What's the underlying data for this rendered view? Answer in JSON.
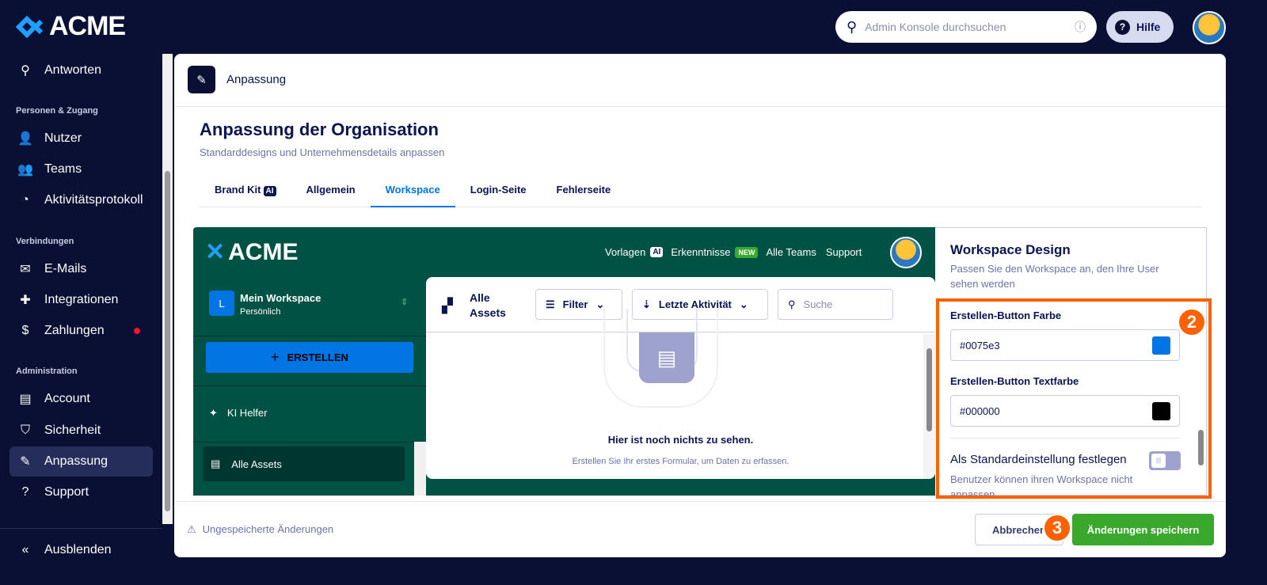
{
  "brand": "ACME",
  "search": {
    "placeholder": "Admin Konsole durchsuchen"
  },
  "help_label": "Hilfe",
  "sidebar": {
    "top": {
      "label": "Antworten"
    },
    "sections": [
      {
        "title": "Personen & Zugang",
        "items": [
          {
            "label": "Nutzer"
          },
          {
            "label": "Teams"
          },
          {
            "label": "Aktivitätsprotokoll"
          }
        ]
      },
      {
        "title": "Verbindungen",
        "items": [
          {
            "label": "E-Mails"
          },
          {
            "label": "Integrationen"
          },
          {
            "label": "Zahlungen"
          }
        ]
      },
      {
        "title": "Administration",
        "items": [
          {
            "label": "Account"
          },
          {
            "label": "Sicherheit"
          },
          {
            "label": "Anpassung"
          },
          {
            "label": "Support"
          }
        ]
      }
    ],
    "collapse": "Ausblenden"
  },
  "page": {
    "header": "Anpassung",
    "title": "Anpassung der Organisation",
    "subtitle": "Standarddesigns und Unternehmensdetails anpassen",
    "tabs": [
      {
        "label": "Brand Kit",
        "badge": "AI"
      },
      {
        "label": "Allgemein"
      },
      {
        "label": "Workspace"
      },
      {
        "label": "Login-Seite"
      },
      {
        "label": "Fehlerseite"
      }
    ]
  },
  "preview": {
    "brand": "ACME",
    "nav": {
      "vorlagen": "Vorlagen",
      "ai": "AI",
      "erkenntnisse": "Erkenntnisse",
      "new": "NEW",
      "teams": "Alle Teams",
      "support": "Support"
    },
    "workspace": {
      "initial": "L",
      "name": "Mein Workspace",
      "sub": "Persönlich"
    },
    "create": "ERSTELLEN",
    "ki": "KI Helfer",
    "alle_assets": "Alle Assets",
    "content": {
      "title_1": "Alle",
      "title_2": "Assets",
      "filter": "Filter",
      "sort": "Letzte Aktivität",
      "search": "Suche",
      "empty_title": "Hier ist noch nichts zu sehen.",
      "empty_sub": "Erstellen Sie Ihr erstes Formular, um Daten zu erfassen."
    }
  },
  "design": {
    "title": "Workspace Design",
    "subtitle": "Passen Sie den Workspace an, den Ihre User sehen werden",
    "btn_color_label": "Erstellen-Button Farbe",
    "btn_color": "#0075e3",
    "text_color_label": "Erstellen-Button Textfarbe",
    "text_color": "#000000",
    "default_label": "Als Standardeinstellung festlegen",
    "default_sub": "Benutzer können ihren Workspace nicht anpassen",
    "default_on": false
  },
  "footer": {
    "unsaved": "Ungespeicherte Änderungen",
    "cancel": "Abbrechen",
    "save": "Änderungen speichern"
  },
  "steps": {
    "two": "2",
    "three": "3"
  }
}
